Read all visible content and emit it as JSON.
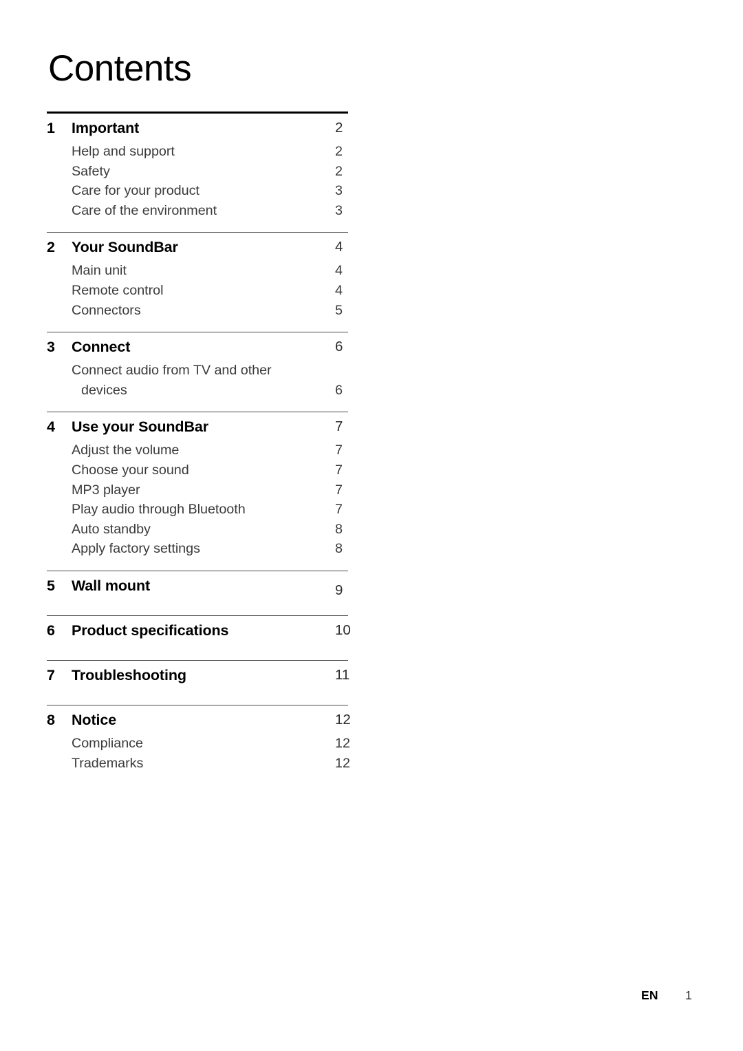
{
  "document": {
    "title": "Contents"
  },
  "toc": {
    "sections": [
      {
        "number": "1",
        "title": "Important",
        "page": "2",
        "entries": [
          {
            "label": "Help and support",
            "page": "2"
          },
          {
            "label": "Safety",
            "page": "2"
          },
          {
            "label": "Care for your product",
            "page": "3"
          },
          {
            "label": "Care of the environment",
            "page": "3"
          }
        ]
      },
      {
        "number": "2",
        "title": "Your SoundBar",
        "page": "4",
        "entries": [
          {
            "label": "Main unit",
            "page": "4"
          },
          {
            "label": "Remote control",
            "page": "4"
          },
          {
            "label": "Connectors",
            "page": "5"
          }
        ]
      },
      {
        "number": "3",
        "title": "Connect",
        "page": "6",
        "entries": [
          {
            "label": "Connect audio from TV and other",
            "page": ""
          },
          {
            "label": "devices",
            "page": "6",
            "continuation": true
          }
        ]
      },
      {
        "number": "4",
        "title": "Use your SoundBar",
        "page": "7",
        "entries": [
          {
            "label": "Adjust the volume",
            "page": "7"
          },
          {
            "label": "Choose your sound",
            "page": "7"
          },
          {
            "label": "MP3 player",
            "page": "7"
          },
          {
            "label": "Play audio through Bluetooth",
            "page": "7"
          },
          {
            "label": "Auto standby",
            "page": "8"
          },
          {
            "label": "Apply factory settings",
            "page": "8"
          }
        ]
      },
      {
        "number": "5",
        "title": "Wall mount",
        "page": "9",
        "entries": []
      },
      {
        "number": "6",
        "title": "Product specifications",
        "page": "10",
        "entries": []
      },
      {
        "number": "7",
        "title": "Troubleshooting",
        "page": "11",
        "entries": []
      },
      {
        "number": "8",
        "title": "Notice",
        "page": "12",
        "entries": [
          {
            "label": "Compliance",
            "page": "12"
          },
          {
            "label": "Trademarks",
            "page": "12"
          }
        ]
      }
    ]
  },
  "footer": {
    "language": "EN",
    "page_number": "1"
  }
}
